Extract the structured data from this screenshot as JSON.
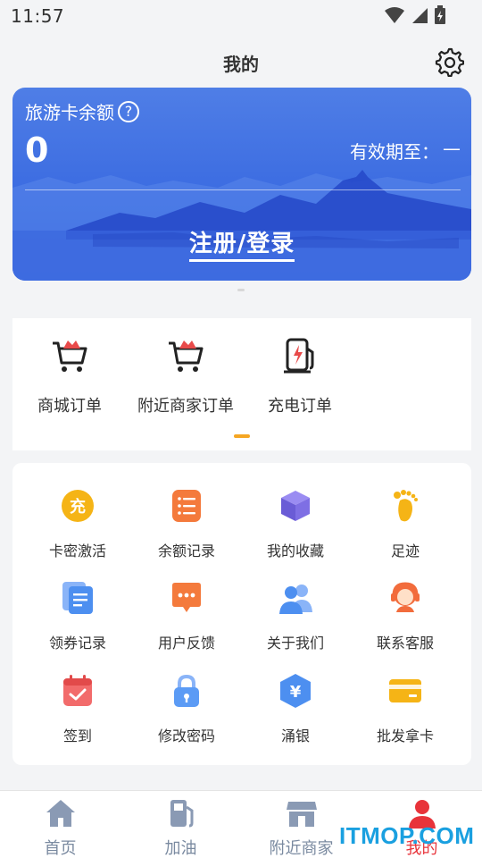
{
  "status_bar": {
    "time": "11:57"
  },
  "header": {
    "title": "我的"
  },
  "card": {
    "title": "旅游卡余额",
    "help_glyph": "?",
    "balance": "0",
    "expiry_label": "有效期至：",
    "expiry_value": "—",
    "login_label": "注册/登录"
  },
  "orders": [
    {
      "label": "商城订单",
      "icon": "shopping-cart-icon"
    },
    {
      "label": "附近商家订单",
      "icon": "shopping-cart-icon"
    },
    {
      "label": "充电订单",
      "icon": "charging-pile-icon"
    }
  ],
  "grid": [
    {
      "label": "卡密激活",
      "icon": "recharge-icon",
      "glyph": "充"
    },
    {
      "label": "余额记录",
      "icon": "list-icon"
    },
    {
      "label": "我的收藏",
      "icon": "cube-icon"
    },
    {
      "label": "足迹",
      "icon": "footprint-icon"
    },
    {
      "label": "领券记录",
      "icon": "document-icon"
    },
    {
      "label": "用户反馈",
      "icon": "message-icon"
    },
    {
      "label": "关于我们",
      "icon": "users-icon"
    },
    {
      "label": "联系客服",
      "icon": "customer-service-icon"
    },
    {
      "label": "签到",
      "icon": "calendar-check-icon"
    },
    {
      "label": "修改密码",
      "icon": "lock-icon"
    },
    {
      "label": "涌银",
      "icon": "yuan-shield-icon",
      "glyph": "¥"
    },
    {
      "label": "批发拿卡",
      "icon": "card-icon"
    }
  ],
  "bottom_nav": [
    {
      "label": "首页",
      "icon": "home-icon"
    },
    {
      "label": "加油",
      "icon": "fuel-icon"
    },
    {
      "label": "附近商家",
      "icon": "store-icon"
    },
    {
      "label": "我的",
      "icon": "user-icon",
      "active": true
    }
  ],
  "watermark": "ITMOP.COM",
  "colors": {
    "card_blue": "#3f6fe2",
    "accent_orange": "#f5a623",
    "active_red": "#e8333a",
    "nav_gray": "#7a8aa0"
  }
}
